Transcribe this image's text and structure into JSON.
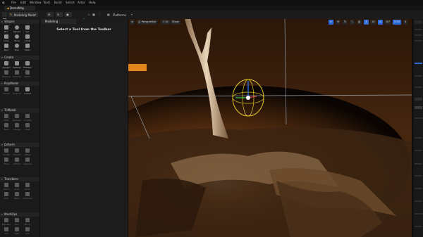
{
  "menu": {
    "items": [
      "File",
      "Edit",
      "Window",
      "Tools",
      "Build",
      "Select",
      "Actor",
      "Help"
    ]
  },
  "document_tab": "DemoMap",
  "toolbar": {
    "mode_label": "Modeling Mode",
    "platforms_label": "Platforms"
  },
  "palette": {
    "sections": [
      {
        "label": "Shapes",
        "tools": [
          "Box",
          "Sphere",
          "Cyl",
          "Cone",
          "Torus",
          "Arrow",
          "Rect",
          "Disc",
          "Stairs"
        ]
      },
      {
        "label": "Create",
        "tools": [
          "PolyExt",
          "PathExt",
          "PathRev",
          "Revolve",
          "Extrude",
          "Plane"
        ]
      },
      {
        "label": "PolyModel",
        "tools": [
          "PolyEd",
          "PolyCut",
          "Cutout"
        ]
      },
      {
        "label": "TriModel",
        "tools": [
          "TriEd",
          "Remesh",
          "Simplify",
          "Weld",
          "Merge",
          "Clean"
        ]
      },
      {
        "label": "Deform",
        "tools": [
          "Sculpt",
          "Smooth",
          "Offset",
          "Warp",
          "Lattice",
          "Displace"
        ]
      },
      {
        "label": "Transform",
        "tools": [
          "Xform",
          "Align",
          "Pivot",
          "Edit",
          "Bake",
          "Duplicate"
        ]
      },
      {
        "label": "MeshOps",
        "tools": [
          "Boolean",
          "Trim",
          "Mirror",
          "Cut",
          "Split",
          "Join"
        ]
      }
    ]
  },
  "modeling_panel": {
    "tab_label": "Modeling",
    "hint": "Select a Tool from the Toolbar"
  },
  "viewport": {
    "perspective_label": "Perspective",
    "lit_label": "Lit",
    "show_label": "Show",
    "snap_value": "10",
    "angle_value": "10°",
    "scale_value": "0.25",
    "camera_speed": "4"
  },
  "colors": {
    "accent_blue": "#2f6bd6",
    "play_green": "#3ad14a",
    "gizmo_yellow": "#e2c91f"
  }
}
